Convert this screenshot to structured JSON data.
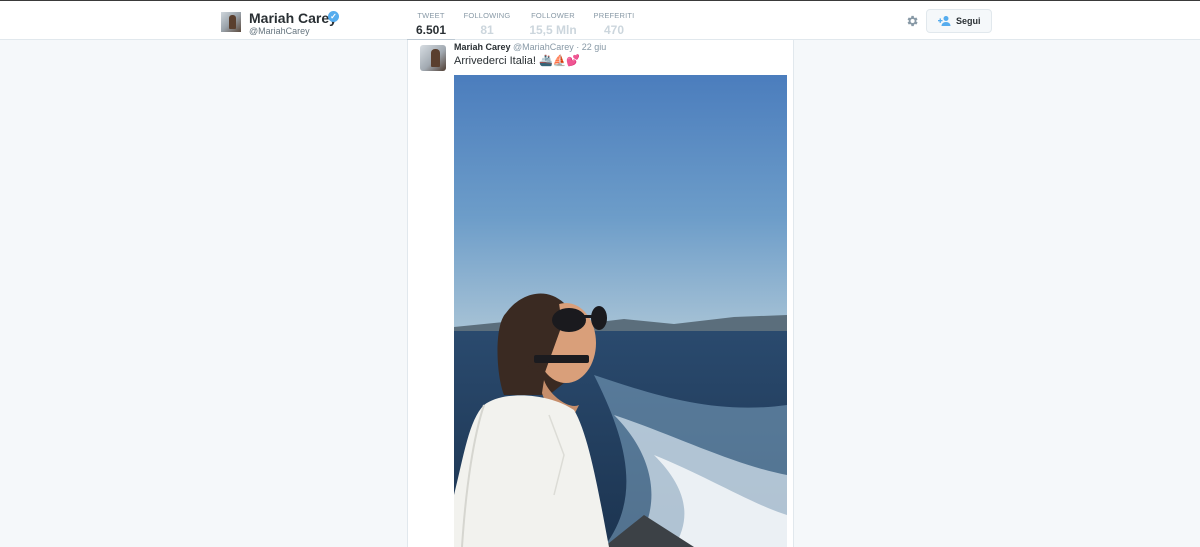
{
  "profile": {
    "name": "Mariah Carey",
    "handle": "@MariahCarey",
    "verified_icon": "verified-badge-icon"
  },
  "nav": {
    "stats": [
      {
        "label": "TWEET",
        "value": "6.501",
        "active": true
      },
      {
        "label": "FOLLOWING",
        "value": "81",
        "active": false
      },
      {
        "label": "FOLLOWER",
        "value": "15,5 Mln",
        "active": false
      },
      {
        "label": "PREFERITI",
        "value": "470",
        "active": false
      }
    ],
    "settings_icon": "gear-icon",
    "follow_label": "Segui"
  },
  "tweet": {
    "name": "Mariah Carey",
    "handle": "@MariahCarey",
    "separator": "·",
    "date": "22 giu",
    "text": "Arrivederci Italia! 🚢⛵💕"
  },
  "colors": {
    "accent": "#55acee",
    "background": "#f5f8fa",
    "text": "#292f33",
    "muted": "#8899a6"
  }
}
